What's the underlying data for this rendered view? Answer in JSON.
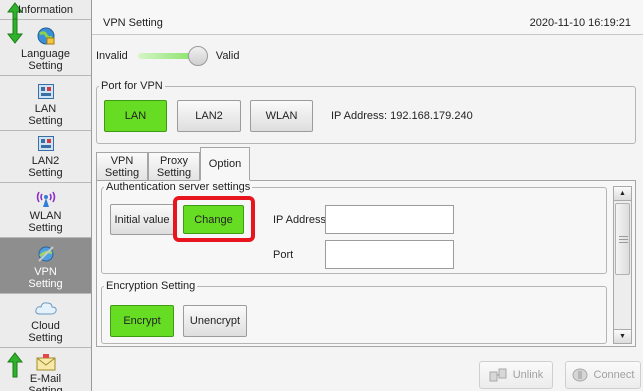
{
  "sidebar": {
    "items": [
      {
        "label": "Information",
        "icon": "info-icon"
      },
      {
        "label": "Language Setting",
        "icon": "language-icon"
      },
      {
        "label": "LAN Setting",
        "icon": "lan-icon"
      },
      {
        "label": "LAN2 Setting",
        "icon": "lan-icon"
      },
      {
        "label": "WLAN Setting",
        "icon": "wlan-icon"
      },
      {
        "label": "VPN Setting",
        "icon": "vpn-icon",
        "active": true
      },
      {
        "label": "Cloud Setting",
        "icon": "cloud-icon"
      },
      {
        "label": "E-Mail Setting",
        "icon": "email-icon"
      }
    ]
  },
  "header": {
    "title": "VPN Setting",
    "datetime": "2020-11-10 16:19:21"
  },
  "vpn_toggle": {
    "off_label": "Invalid",
    "on_label": "Valid",
    "state": "Valid"
  },
  "port": {
    "legend": "Port for VPN",
    "buttons": [
      "LAN",
      "LAN2",
      "WLAN"
    ],
    "selected": "LAN",
    "ip_text": "IP Address: 192.168.179.240"
  },
  "tabs": [
    {
      "line1": "VPN",
      "line2": "Setting"
    },
    {
      "line1": "Proxy",
      "line2": "Setting"
    },
    {
      "line1": "Option",
      "line2": ""
    }
  ],
  "active_tab": "Option",
  "auth": {
    "legend": "Authentication server settings",
    "initial_label": "Initial value",
    "change_label": "Change",
    "ip_label": "IP Address",
    "ip_value": "",
    "port_label": "Port",
    "port_value": ""
  },
  "encryption": {
    "legend": "Encryption Setting",
    "encrypt_label": "Encrypt",
    "unencrypt_label": "Unencrypt",
    "selected": "Encrypt"
  },
  "bottom": {
    "unlink_label": "Unlink",
    "connect_label": "Connect"
  },
  "colors": {
    "accent_green": "#66dd22",
    "highlight_red": "#e8141e",
    "sidebar_active": "#8e8e8e"
  }
}
